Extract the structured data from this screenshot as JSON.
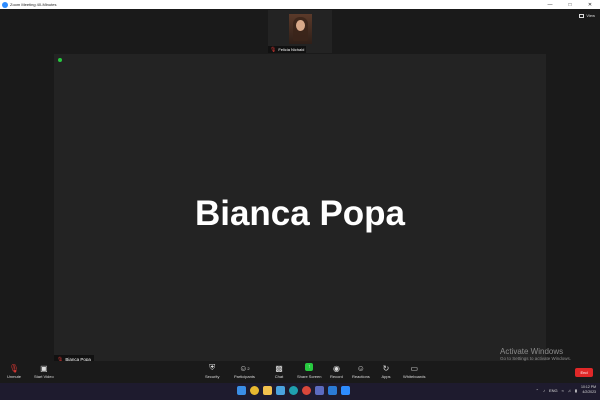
{
  "window": {
    "title": "Zoom Meeting 40-Minutes"
  },
  "view": {
    "label": "View"
  },
  "thumbnail": {
    "name": "Felicia Nichald"
  },
  "main": {
    "display_name": "Bianca Popa",
    "name_tag": "Bianca Popa"
  },
  "watermark": {
    "line1": "Activate Windows",
    "line2": "Go to Settings to activate Windows."
  },
  "toolbar": {
    "unmute": "Unmute",
    "start_video": "Start Video",
    "security": "Security",
    "participants": "Participants",
    "participants_count": "2",
    "chat": "Chat",
    "share_screen": "Share Screen",
    "record": "Record",
    "reactions": "Reactions",
    "apps": "Apps",
    "whiteboards": "Whiteboards",
    "end": "End"
  },
  "taskbar": {
    "language": "ENG",
    "time": "10:12 PM",
    "date": "4/2/2023"
  },
  "colors": {
    "accent_blue": "#2d8cff",
    "end_red": "#e02828",
    "share_green": "#27c93f"
  }
}
